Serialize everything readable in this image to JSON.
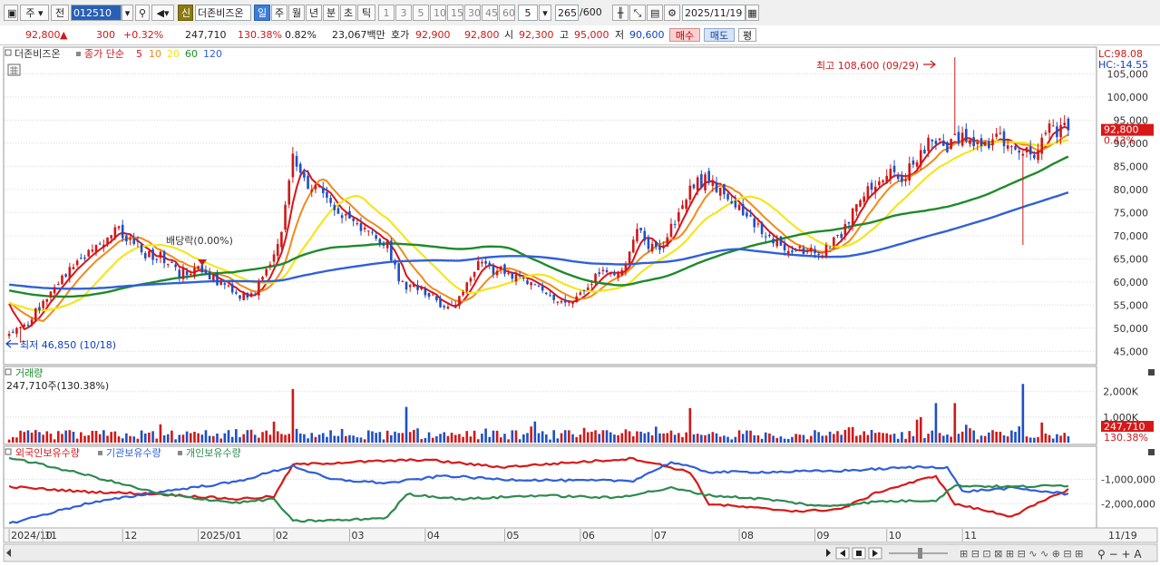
{
  "toolbar": {
    "period_label": "주",
    "prefix": "전",
    "code": "012510",
    "new_badge": "신",
    "stock_name": "더존비즈온",
    "periods": [
      "일",
      "주",
      "월",
      "년",
      "분",
      "초",
      "틱"
    ],
    "intervals": [
      "1",
      "3",
      "5",
      "10",
      "15",
      "30",
      "45",
      "60"
    ],
    "interval_value": "5",
    "count": "265",
    "count_total": "/600",
    "date": "2025/11/19"
  },
  "quote": {
    "price": "92,800",
    "change_arrow": "▲",
    "change": "300",
    "change_pct": "+0.32%",
    "volume": "247,710",
    "volume_ratio": "130.38%",
    "turnover": "0.82%",
    "amount": "23,067백만",
    "ask_label": "호가",
    "ask": "92,900",
    "bid": "92,800",
    "open_label": "시",
    "open": "92,300",
    "high_label": "고",
    "high": "95,000",
    "low_label": "저",
    "low": "90,600",
    "buy": "매수",
    "sell": "매도",
    "eval": "평"
  },
  "colors": {
    "up": "#d01818",
    "down": "#1f4fc4",
    "ma5": "#d8141a",
    "ma10": "#f08a1a",
    "ma20": "#f4e61e",
    "ma60": "#1e8a2a",
    "ma120": "#3060d8",
    "foreign": "#d81818",
    "institution": "#2f5fd8",
    "individual": "#2e8a50"
  },
  "chart_data": [
    {
      "type": "candlestick",
      "title": "더존비즈온",
      "legend": {
        "label": "종가 단순",
        "periods": [
          "5",
          "10",
          "20",
          "60",
          "120"
        ]
      },
      "right_info": {
        "lc": "LC:98.08",
        "hc": "HC:-14.55"
      },
      "y_ticks": [
        45000,
        50000,
        55000,
        60000,
        65000,
        70000,
        75000,
        80000,
        85000,
        90000,
        95000,
        100000,
        105000
      ],
      "y_tick_labels": [
        "45,000",
        "50,000",
        "55,000",
        "60,000",
        "65,000",
        "70,000",
        "75,000",
        "80,000",
        "85,000",
        "90,000",
        "95,000",
        "100,000",
        "105,000"
      ],
      "ylim": [
        42500,
        110000
      ],
      "current_price_label": "92,800",
      "current_pct_label": "0.43%",
      "current_price": 92800,
      "annotations": {
        "high": "최고 108,600 (09/29)",
        "high_value": 108600,
        "low": "최저 46,850 (10/18)",
        "low_value": 46850,
        "dividend": "배당락(0.00%)"
      },
      "anchors": [
        [
          0,
          48000
        ],
        [
          5,
          51000
        ],
        [
          10,
          57000
        ],
        [
          15,
          62000
        ],
        [
          20,
          66000
        ],
        [
          25,
          69000
        ],
        [
          28,
          71500
        ],
        [
          32,
          69000
        ],
        [
          36,
          66000
        ],
        [
          40,
          65500
        ],
        [
          45,
          62000
        ],
        [
          50,
          63000
        ],
        [
          55,
          60000
        ],
        [
          60,
          57500
        ],
        [
          64,
          57000
        ],
        [
          68,
          62000
        ],
        [
          72,
          70000
        ],
        [
          75,
          87000
        ],
        [
          78,
          82000
        ],
        [
          82,
          80000
        ],
        [
          86,
          75500
        ],
        [
          90,
          73000
        ],
        [
          95,
          70500
        ],
        [
          100,
          68000
        ],
        [
          103,
          60000
        ],
        [
          106,
          59000
        ],
        [
          110,
          58000
        ],
        [
          115,
          54000
        ],
        [
          118,
          56000
        ],
        [
          121,
          60000
        ],
        [
          124,
          64000
        ],
        [
          128,
          62500
        ],
        [
          132,
          62000
        ],
        [
          136,
          60500
        ],
        [
          140,
          58000
        ],
        [
          144,
          56000
        ],
        [
          148,
          55500
        ],
        [
          152,
          58000
        ],
        [
          156,
          62000
        ],
        [
          160,
          61000
        ],
        [
          163,
          65000
        ],
        [
          166,
          72000
        ],
        [
          169,
          68000
        ],
        [
          172,
          67000
        ],
        [
          176,
          73000
        ],
        [
          180,
          80000
        ],
        [
          184,
          82500
        ],
        [
          188,
          80000
        ],
        [
          192,
          77000
        ],
        [
          196,
          73000
        ],
        [
          200,
          70000
        ],
        [
          204,
          68000
        ],
        [
          208,
          67000
        ],
        [
          212,
          66500
        ],
        [
          216,
          67000
        ],
        [
          220,
          70000
        ],
        [
          224,
          77000
        ],
        [
          228,
          81000
        ],
        [
          232,
          84000
        ],
        [
          236,
          82000
        ],
        [
          240,
          87000
        ],
        [
          244,
          91000
        ],
        [
          248,
          89500
        ],
        [
          252,
          92000
        ],
        [
          256,
          89000
        ],
        [
          260,
          91000
        ],
        [
          265,
          90500
        ],
        [
          270,
          87000
        ],
        [
          275,
          93000
        ],
        [
          280,
          92800
        ]
      ],
      "ma_periods": [
        5,
        10,
        20,
        60,
        120
      ],
      "warmup_bars": 120
    },
    {
      "type": "bar",
      "title": "거래량",
      "value_label": "247,710주(130.38%)",
      "y_ticks": [
        1000000,
        2000000
      ],
      "y_tick_labels": [
        "1,000K",
        "2,000K"
      ],
      "ylim": [
        0,
        2700000
      ],
      "current_volume": 247710,
      "current_label": "247,710",
      "current_pct_label": "130.38%"
    },
    {
      "type": "line",
      "legend": [
        "외국인보유수량",
        "기관보유수량",
        "개인보유수량"
      ],
      "y_ticks": [
        -1000000,
        -2000000
      ],
      "y_tick_labels": [
        "-1,000,000",
        "-2,000,000"
      ],
      "ylim": [
        -2900000,
        200000
      ],
      "series": [
        {
          "name": "외국인보유수량",
          "anchors": [
            [
              0,
              -1300000
            ],
            [
              20,
              -1500000
            ],
            [
              40,
              -1600000
            ],
            [
              60,
              -1800000
            ],
            [
              70,
              -1700000
            ],
            [
              75,
              -400000
            ],
            [
              90,
              -300000
            ],
            [
              110,
              -200000
            ],
            [
              130,
              -500000
            ],
            [
              150,
              -300000
            ],
            [
              165,
              -150000
            ],
            [
              180,
              -700000
            ],
            [
              185,
              -2000000
            ],
            [
              200,
              -2200000
            ],
            [
              210,
              -2300000
            ],
            [
              220,
              -2200000
            ],
            [
              230,
              -1500000
            ],
            [
              245,
              -850000
            ],
            [
              250,
              -2000000
            ],
            [
              265,
              -2500000
            ],
            [
              280,
              -1400000
            ],
            [
              285,
              -1300000
            ]
          ]
        },
        {
          "name": "기관보유수량",
          "anchors": [
            [
              0,
              -2800000
            ],
            [
              20,
              -2000000
            ],
            [
              40,
              -1500000
            ],
            [
              60,
              -1100000
            ],
            [
              75,
              -450000
            ],
            [
              85,
              -1000000
            ],
            [
              100,
              -1150000
            ],
            [
              115,
              -850000
            ],
            [
              130,
              -1000000
            ],
            [
              150,
              -1050000
            ],
            [
              165,
              -1050000
            ],
            [
              175,
              -300000
            ],
            [
              185,
              -700000
            ],
            [
              200,
              -700000
            ],
            [
              220,
              -650000
            ],
            [
              240,
              -500000
            ],
            [
              248,
              -500000
            ],
            [
              252,
              -1500000
            ],
            [
              265,
              -1350000
            ],
            [
              280,
              -1600000
            ],
            [
              285,
              -1750000
            ]
          ]
        },
        {
          "name": "개인보유수량",
          "anchors": [
            [
              0,
              -100000
            ],
            [
              20,
              -800000
            ],
            [
              40,
              -1600000
            ],
            [
              60,
              -1950000
            ],
            [
              70,
              -1800000
            ],
            [
              75,
              -2700000
            ],
            [
              90,
              -2650000
            ],
            [
              100,
              -2550000
            ],
            [
              105,
              -1600000
            ],
            [
              120,
              -1800000
            ],
            [
              140,
              -1650000
            ],
            [
              160,
              -1750000
            ],
            [
              175,
              -1350000
            ],
            [
              185,
              -1650000
            ],
            [
              200,
              -1800000
            ],
            [
              215,
              -2100000
            ],
            [
              230,
              -1900000
            ],
            [
              245,
              -1850000
            ],
            [
              250,
              -1250000
            ],
            [
              265,
              -1300000
            ],
            [
              280,
              -1250000
            ],
            [
              285,
              -1300000
            ]
          ]
        }
      ]
    }
  ],
  "x_axis": {
    "labels": [
      "2024/10",
      "11",
      "12",
      "2025/01",
      "02",
      "03",
      "04",
      "05",
      "06",
      "07",
      "08",
      "09",
      "10",
      "11"
    ],
    "end_label": "11/19"
  }
}
